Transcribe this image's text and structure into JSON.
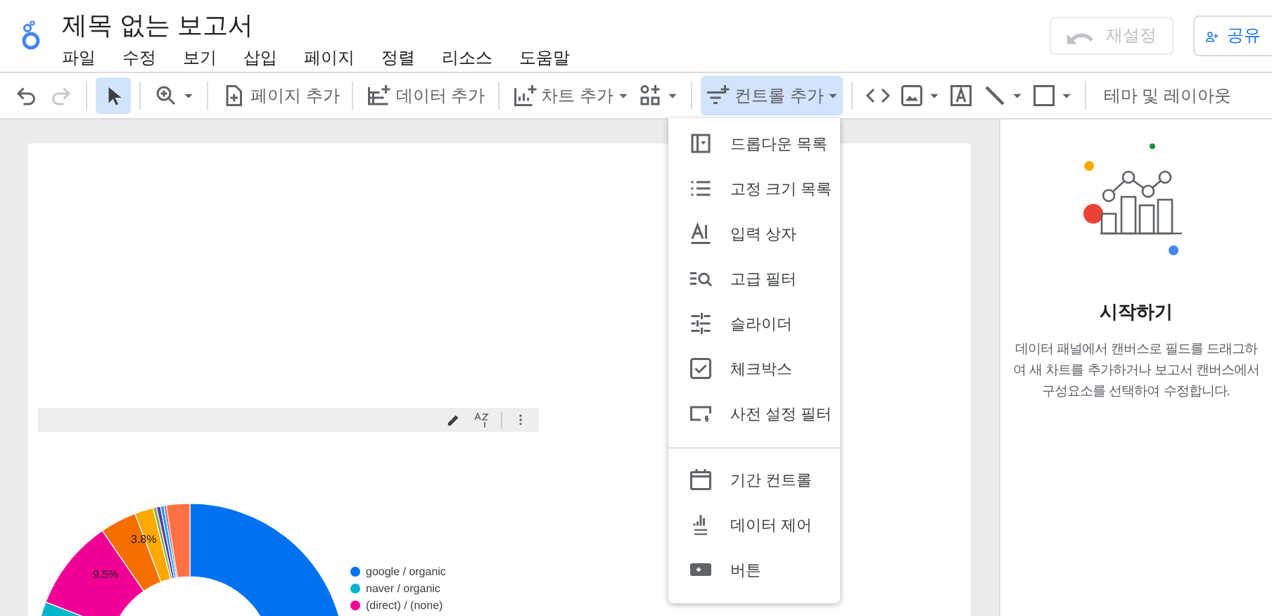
{
  "header": {
    "title": "제목 없는 보고서",
    "menu": [
      "파일",
      "수정",
      "보기",
      "삽입",
      "페이지",
      "정렬",
      "리소스",
      "도움말"
    ],
    "reset_button": {
      "label": "재설정",
      "disabled": true
    },
    "share_button": {
      "label": "공유"
    }
  },
  "toolbar": {
    "undo": {
      "disabled": false
    },
    "redo": {
      "disabled": true
    },
    "pointer": {
      "selected": true
    },
    "add_page": {
      "label": "페이지 추가"
    },
    "add_data": {
      "label": "데이터 추가"
    },
    "add_chart": {
      "label": "차트 추가"
    },
    "add_control": {
      "label": "컨트롤 추가",
      "selected": true
    },
    "theme": {
      "label": "테마 및 레이아웃"
    }
  },
  "control_menu": {
    "sections": [
      {
        "items": [
          {
            "label": "드롭다운 목록"
          },
          {
            "label": "고정 크기 목록"
          },
          {
            "label": "입력 상자"
          },
          {
            "label": "고급 필터"
          },
          {
            "label": "슬라이더"
          },
          {
            "label": "체크박스"
          },
          {
            "label": "사전 설정 필터"
          }
        ]
      },
      {
        "items": [
          {
            "label": "기간 컨트롤"
          },
          {
            "label": "데이터 제어"
          },
          {
            "label": "버튼"
          }
        ]
      }
    ]
  },
  "canvas": {
    "chart": {
      "data_labels": [
        "3.8%",
        "9.5%"
      ],
      "legend": [
        {
          "label": "google / organic",
          "color": "#0072f0"
        },
        {
          "label": "naver / organic",
          "color": "#00b6cb"
        },
        {
          "label": "(direct) / (none)",
          "color": "#f10096"
        }
      ]
    }
  },
  "side_panel": {
    "title": "시작하기",
    "description": "데이터 패널에서 캔버스로 필드를 드래그하여 새 차트를 추가하거나 보고서 캔버스에서 구성요소를 선택하여 수정합니다."
  }
}
